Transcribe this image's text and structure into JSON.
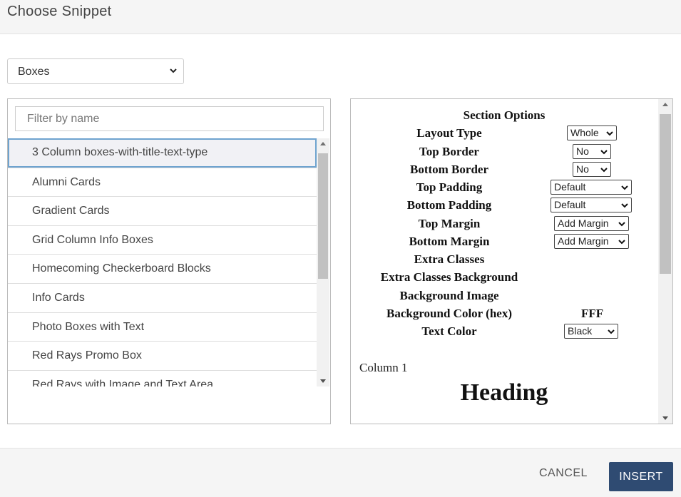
{
  "dialog": {
    "title": "Choose Snippet"
  },
  "category": {
    "selected": "Boxes"
  },
  "filter": {
    "placeholder": "Filter by name",
    "value": ""
  },
  "snippets": [
    "3 Column boxes-with-title-text-type",
    "Alumni Cards",
    "Gradient Cards",
    "Grid Column Info Boxes",
    "Homecoming Checkerboard Blocks",
    "Info Cards",
    "Photo Boxes with Text",
    "Red Rays Promo Box",
    "Red Rays with Image and Text Area"
  ],
  "selected_snippet_index": 0,
  "preview": {
    "section_title": "Section Options",
    "options": {
      "layout_type": {
        "label": "Layout Type",
        "value": "Whole"
      },
      "top_border": {
        "label": "Top Border",
        "value": "No"
      },
      "bottom_border": {
        "label": "Bottom Border",
        "value": "No"
      },
      "top_padding": {
        "label": "Top Padding",
        "value": "Default"
      },
      "bottom_padding": {
        "label": "Bottom Padding",
        "value": "Default"
      },
      "top_margin": {
        "label": "Top Margin",
        "value": "Add Margin"
      },
      "bottom_margin": {
        "label": "Bottom Margin",
        "value": "Add Margin"
      },
      "extra_classes": {
        "label": "Extra Classes"
      },
      "extra_classes_background": {
        "label": "Extra Classes Background"
      },
      "background_image": {
        "label": "Background Image"
      },
      "background_color": {
        "label": "Background Color (hex)",
        "value": "FFF"
      },
      "text_color": {
        "label": "Text Color",
        "value": "Black"
      }
    },
    "column_label": "Column 1",
    "heading": "Heading"
  },
  "footer": {
    "cancel_label": "CANCEL",
    "insert_label": "INSERT"
  },
  "colors": {
    "primary_button": "#2f4b72",
    "selected_border": "#6ea3cf",
    "header_bg": "#f5f5f5"
  }
}
